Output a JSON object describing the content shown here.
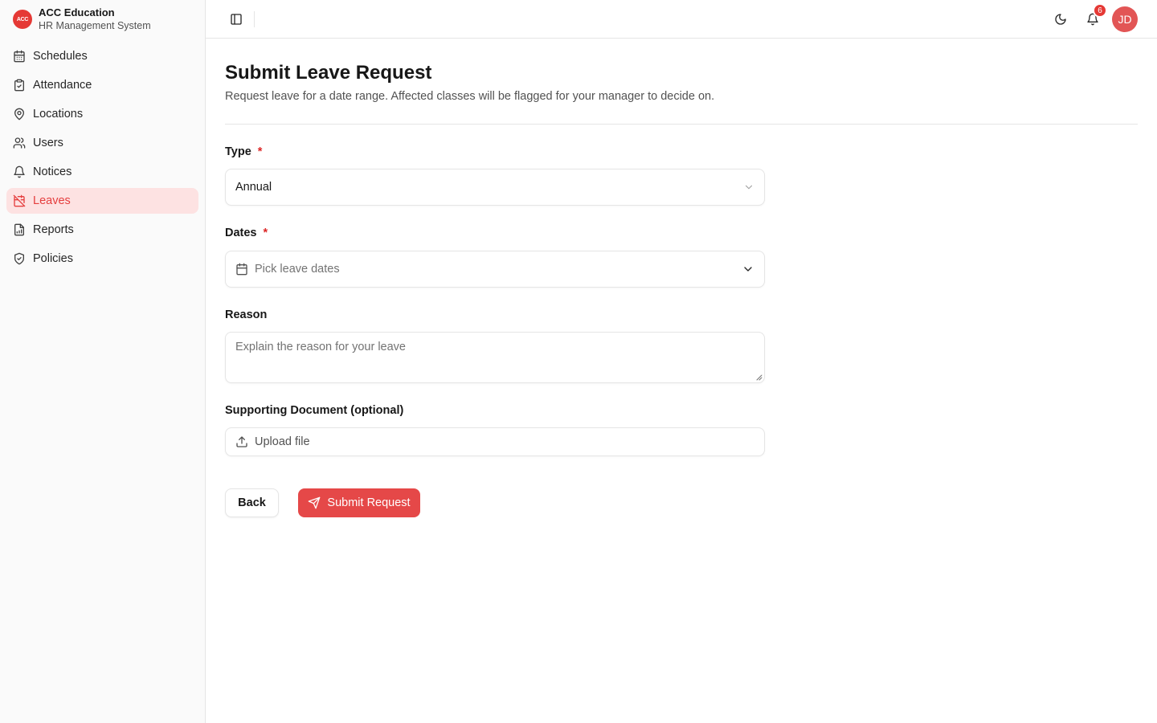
{
  "brand": {
    "logo_text": "ACC",
    "name": "ACC Education",
    "subtitle": "HR Management System"
  },
  "sidebar": {
    "items": [
      {
        "label": "Schedules",
        "icon": "calendar-icon",
        "active": false
      },
      {
        "label": "Attendance",
        "icon": "clipboard-check-icon",
        "active": false
      },
      {
        "label": "Locations",
        "icon": "map-pin-icon",
        "active": false
      },
      {
        "label": "Users",
        "icon": "users-icon",
        "active": false
      },
      {
        "label": "Notices",
        "icon": "bell-icon",
        "active": false
      },
      {
        "label": "Leaves",
        "icon": "calendar-off-icon",
        "active": true
      },
      {
        "label": "Reports",
        "icon": "file-chart-icon",
        "active": false
      },
      {
        "label": "Policies",
        "icon": "shield-check-icon",
        "active": false
      }
    ]
  },
  "header": {
    "notification_count": "6",
    "avatar_initials": "JD"
  },
  "page": {
    "title": "Submit Leave Request",
    "description": "Request leave for a date range. Affected classes will be flagged for your manager to decide on."
  },
  "form": {
    "type": {
      "label": "Type",
      "required_mark": "*",
      "value": "Annual"
    },
    "dates": {
      "label": "Dates",
      "required_mark": "*",
      "placeholder": "Pick leave dates"
    },
    "reason": {
      "label": "Reason",
      "placeholder": "Explain the reason for your leave"
    },
    "document": {
      "label": "Supporting Document (optional)",
      "upload_label": "Upload file"
    }
  },
  "actions": {
    "back_label": "Back",
    "submit_label": "Submit Request"
  },
  "colors": {
    "accent": "#e53e3e",
    "active_bg": "#fde2e2"
  }
}
